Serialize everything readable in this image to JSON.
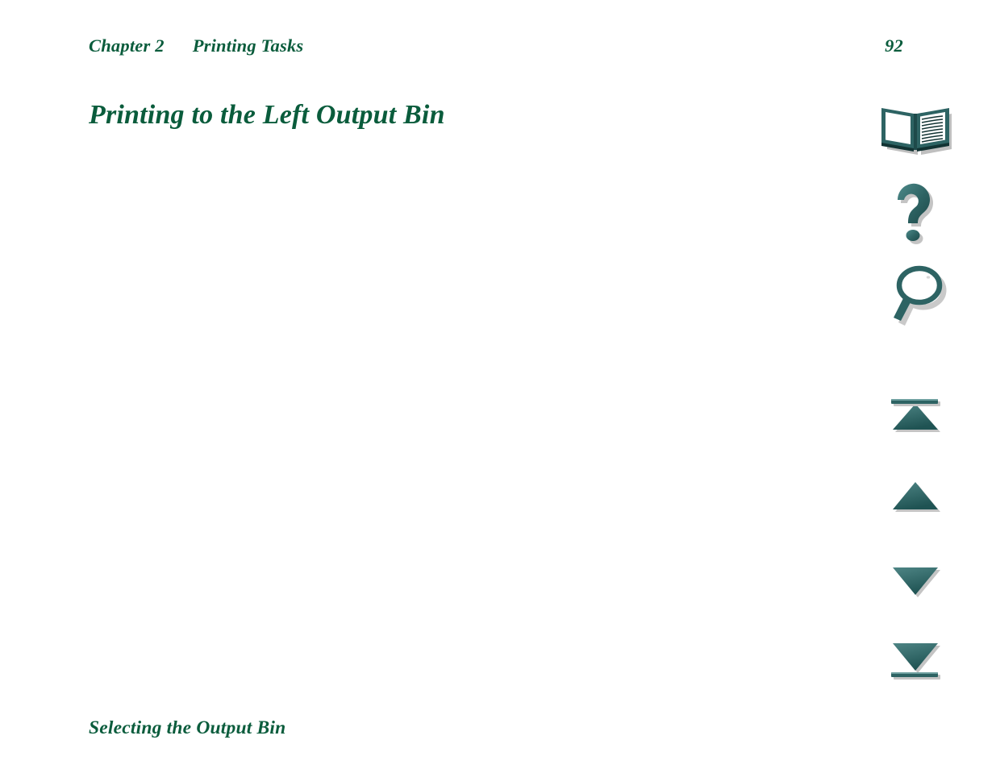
{
  "document": {
    "title": "Printing to the Left Output Bin",
    "page_number": "92"
  },
  "header": {
    "chapter_label": "Chapter 2",
    "chapter_name": "Printing Tasks",
    "page_number": "92"
  },
  "main": {
    "title": "Printing to the Left Output Bin",
    "body_text": ""
  },
  "footer": {
    "section_heading": "Selecting the Output Bin"
  },
  "nav_rail": {
    "items": [
      {
        "name": "contents-icon",
        "label": "Contents"
      },
      {
        "name": "help-icon",
        "label": "Help"
      },
      {
        "name": "search-icon",
        "label": "Search"
      },
      {
        "name": "first-page-icon",
        "label": "First Page"
      },
      {
        "name": "previous-page-icon",
        "label": "Previous Page"
      },
      {
        "name": "next-page-icon",
        "label": "Next Page"
      },
      {
        "name": "last-page-icon",
        "label": "Last Page"
      }
    ]
  },
  "colors": {
    "text_green": "#0A5C3C",
    "icon_teal": "#2D6363",
    "icon_teal_light": "#4A8585",
    "icon_teal_dark": "#1E4A4A",
    "shadow_gray": "#BFBFBF",
    "background": "#FFFFFF"
  }
}
